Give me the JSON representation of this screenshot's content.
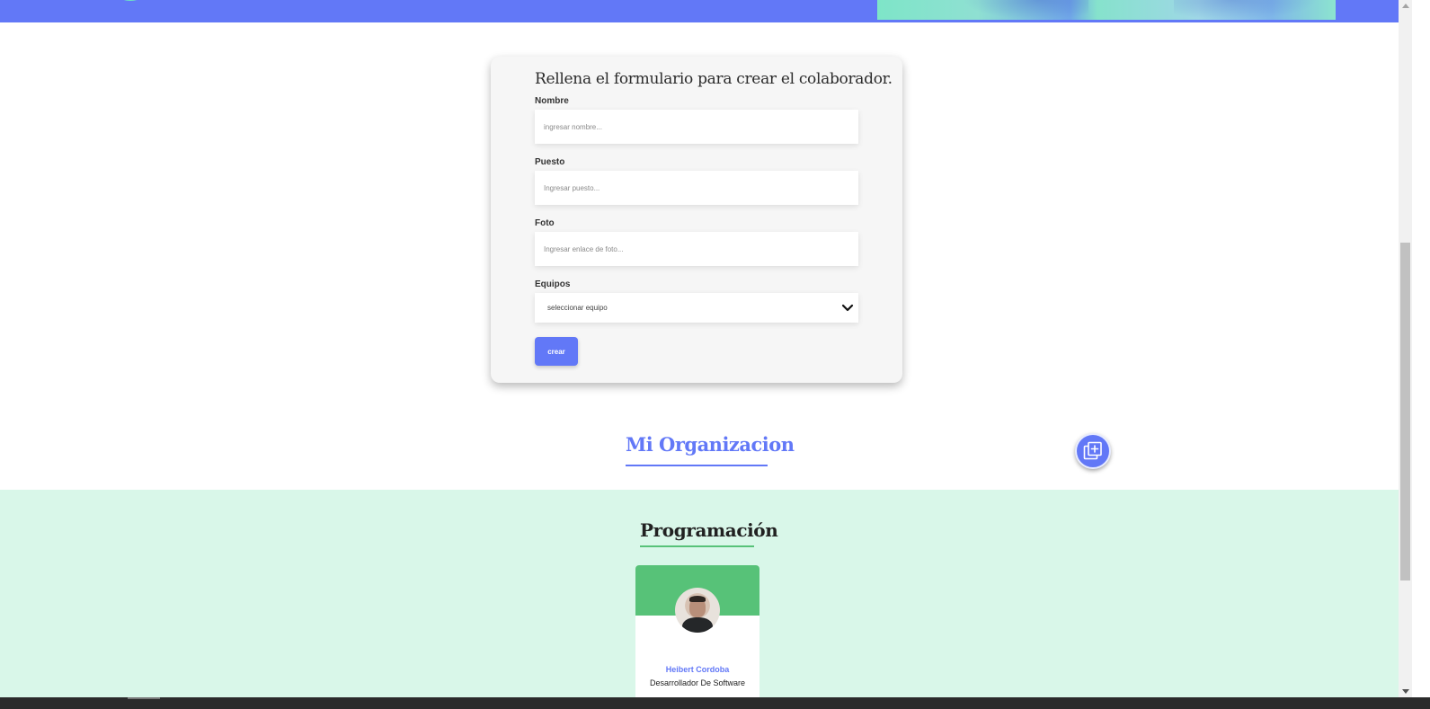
{
  "form": {
    "title": "Rellena el formulario para crear el colaborador.",
    "fields": [
      {
        "label": "Nombre",
        "placeholder": "ingresar nombre..."
      },
      {
        "label": "Puesto",
        "placeholder": "Ingresar puesto..."
      },
      {
        "label": "Foto",
        "placeholder": "Ingresar enlace de foto..."
      }
    ],
    "select": {
      "label": "Equipos",
      "value": "seleccionar equipo"
    },
    "submit_label": "crear"
  },
  "organization": {
    "title": "Mi Organizacion",
    "add_icon": "add-layers-icon"
  },
  "teams": [
    {
      "title": "Programación",
      "primary_color": "#57c278",
      "secondary_color": "#d9f7e9",
      "members": [
        {
          "name": "Heibert Cordoba",
          "role": "Desarrollador De Software"
        }
      ]
    }
  ],
  "colors": {
    "brand": "#6278f7",
    "accent": "#6ce3c4"
  }
}
